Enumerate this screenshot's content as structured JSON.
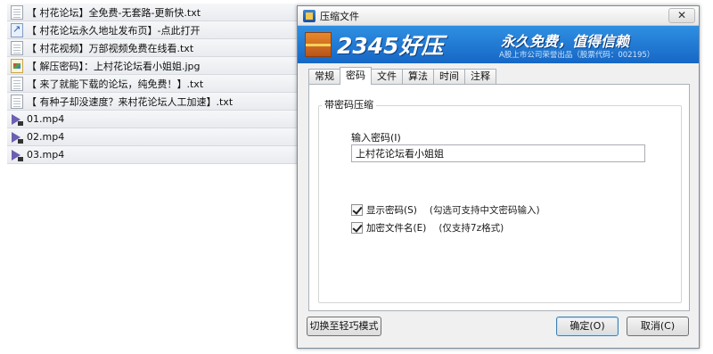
{
  "files": [
    {
      "icon": "text-file-icon",
      "kind": "doc",
      "name": "【 村花论坛】全免费-无套路-更新快.txt"
    },
    {
      "icon": "url-shortcut-icon",
      "kind": "link",
      "name": "【 村花论坛永久地址发布页】-点此打开"
    },
    {
      "icon": "text-file-icon",
      "kind": "doc",
      "name": "【 村花视频】万部视频免费在线看.txt"
    },
    {
      "icon": "image-file-icon",
      "kind": "img",
      "name": "【 解压密码】：上村花论坛看小姐姐.jpg"
    },
    {
      "icon": "text-file-icon",
      "kind": "doc",
      "name": "【 来了就能下载的论坛，纯免费！】.txt"
    },
    {
      "icon": "text-file-icon",
      "kind": "doc",
      "name": "【 有种子却没速度？来村花论坛人工加速】.txt"
    },
    {
      "icon": "video-file-icon",
      "kind": "media",
      "name": "01.mp4"
    },
    {
      "icon": "video-file-icon",
      "kind": "media",
      "name": "02.mp4"
    },
    {
      "icon": "video-file-icon",
      "kind": "media",
      "name": "03.mp4"
    }
  ],
  "dialog": {
    "title": "压缩文件",
    "close_label": "✕",
    "banner": {
      "brand": "2345好压",
      "slogan": "永久免费，值得信赖",
      "subline": "A股上市公司荣誉出品（股票代码：002195）"
    },
    "tabs": [
      {
        "label": "常规",
        "active": false
      },
      {
        "label": "密码",
        "active": true
      },
      {
        "label": "文件",
        "active": false
      },
      {
        "label": "算法",
        "active": false
      },
      {
        "label": "时间",
        "active": false
      },
      {
        "label": "注释",
        "active": false
      }
    ],
    "group_label": "带密码压缩",
    "password_label": "输入密码(I)",
    "password_value": "上村花论坛看小姐姐",
    "show_password": {
      "label": "显示密码(S)",
      "checked": true,
      "note": "(勾选可支持中文密码输入)"
    },
    "encrypt_names": {
      "label": "加密文件名(E)",
      "checked": true,
      "note": "(仅支持7z格式)"
    },
    "mode_button": "切换至轻巧模式",
    "ok_button": "确定(O)",
    "cancel_button": "取消(C)"
  }
}
